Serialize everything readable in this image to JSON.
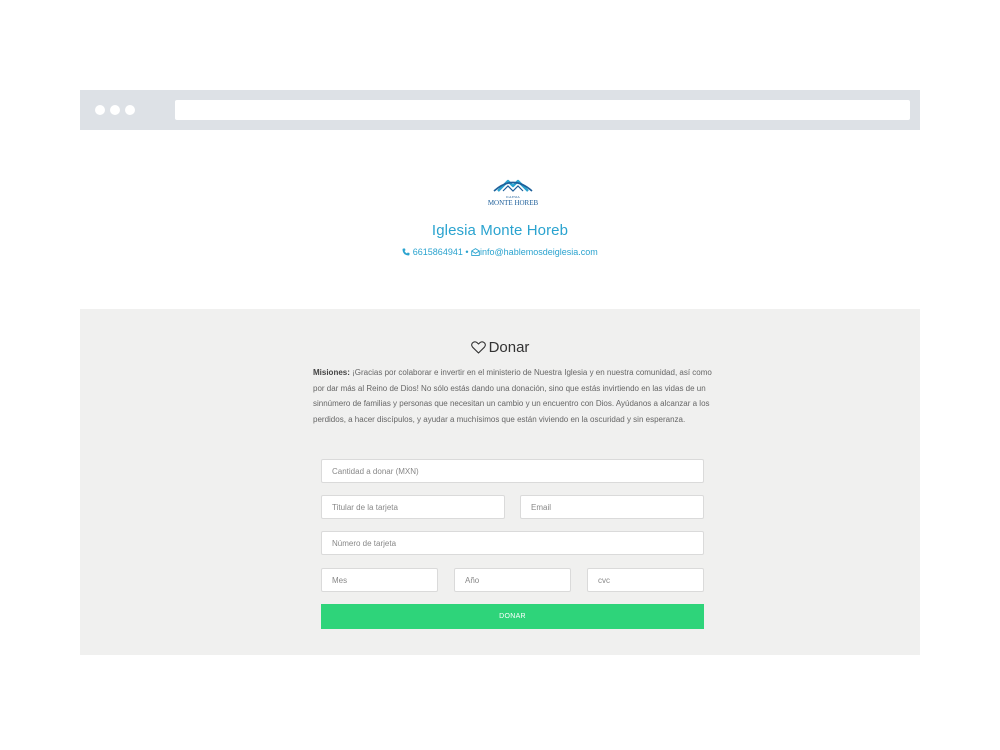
{
  "church": {
    "logo_text_small": "IGLESIA",
    "logo_text": "MONTE HOREB",
    "name": "Iglesia Monte Horeb",
    "phone": "6615864941",
    "separator": "•",
    "email": "info@hablemosdeiglesia.com",
    "accent_color": "#2aa3cf"
  },
  "donate": {
    "title": "Donar",
    "mission_label": "Misiones:",
    "mission_text": " ¡Gracias por colaborar e invertir en el ministerio de Nuestra Iglesia y en nuestra comunidad, así como por dar más al Reino de Dios! No sólo estás dando una donación, sino que estás invirtiendo en las vidas de un sinnúmero de familias y personas que necesitan un cambio y un encuentro con Dios. Ayúdanos a alcanzar a los perdidos, a hacer discípulos, y ayudar a muchísimos que están viviendo en la oscuridad y sin esperanza.",
    "fields": {
      "amount_placeholder": "Cantidad a donar (MXN)",
      "holder_placeholder": "Titular de la tarjeta",
      "email_placeholder": "Email",
      "card_placeholder": "Número de tarjeta",
      "month_placeholder": "Mes",
      "year_placeholder": "Año",
      "cvc_placeholder": "cvc"
    },
    "button_label": "DONAR",
    "button_color": "#2ed47a"
  }
}
